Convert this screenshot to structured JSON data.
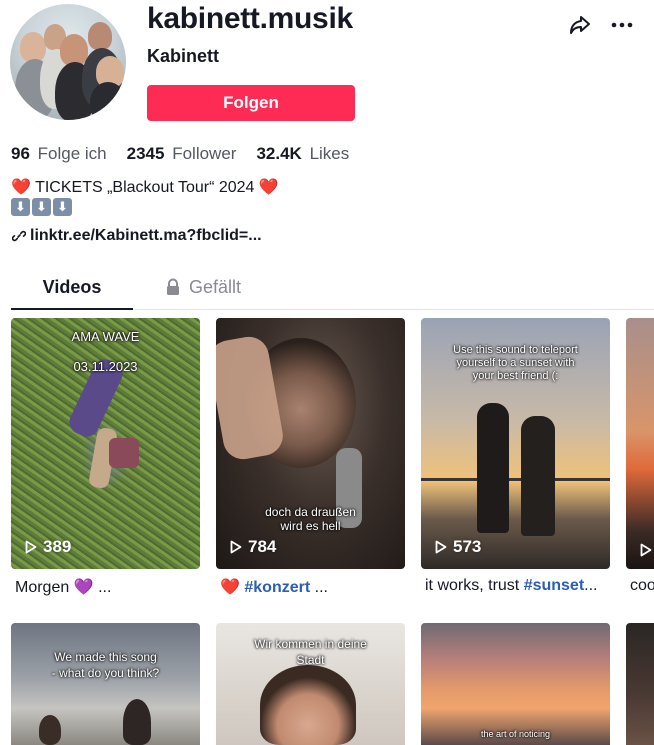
{
  "profile": {
    "username": "kabinett.musik",
    "display_name": "Kabinett",
    "follow_label": "Folgen"
  },
  "stats": [
    {
      "value": "96",
      "label": "Folge ich"
    },
    {
      "value": "2345",
      "label": "Follower"
    },
    {
      "value": "32.4K",
      "label": "Likes"
    }
  ],
  "bio": {
    "line1": "TICKETS „Blackout Tour“ 2024",
    "heart": "❤️",
    "arrow": "⬇"
  },
  "link": {
    "text": "linktr.ee/Kabinett.ma?fbclid=..."
  },
  "tabs": {
    "videos": "Videos",
    "liked": "Gefällt"
  },
  "videos": [
    {
      "views": "389",
      "overlay_top": "AMA WAVE",
      "overlay_sub": "03.11.2023",
      "caption_text": "Morgen",
      "caption_emoji": "💜",
      "caption_suffix": "..."
    },
    {
      "views": "784",
      "overlay_bottom_1": "doch da draußen",
      "overlay_bottom_2": "wird es hell",
      "caption_emoji": "❤️",
      "caption_tag": "#konzert",
      "caption_suffix": "..."
    },
    {
      "views": "573",
      "overlay_top_1": "Use this sound to teleport",
      "overlay_top_2": "yourself to a sunset with",
      "overlay_top_3": "your best friend (:",
      "caption_text": "it works, trust",
      "caption_tag": "#sunset",
      "caption_suffix": "..."
    },
    {
      "caption_text": "coo"
    }
  ],
  "videos_row2": [
    {
      "overlay_1": "We made this song",
      "overlay_2": "- what do you think?"
    },
    {
      "overlay_1": "Wir kommen in deine",
      "overlay_2": "Stadt"
    },
    {
      "overlay_1": "the art of noticing"
    }
  ],
  "colors": {
    "follow": "#fe2c55",
    "tag": "#2b5db9"
  }
}
